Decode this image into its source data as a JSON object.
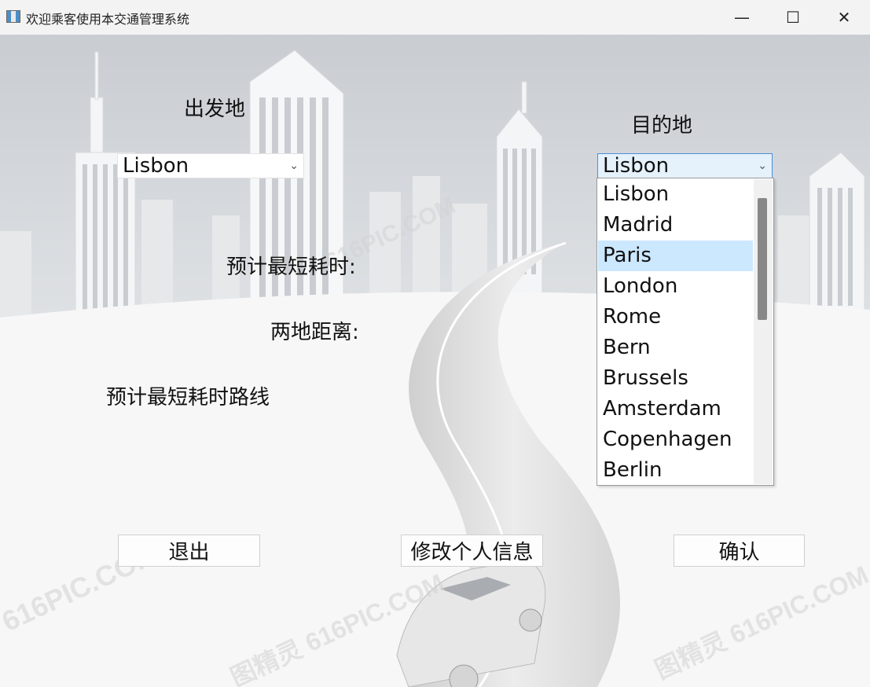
{
  "window": {
    "title": "欢迎乘客使用本交通管理系统",
    "minimize_glyph": "—",
    "maximize_glyph": "☐",
    "close_glyph": "✕"
  },
  "form": {
    "origin_label": "出发地",
    "destination_label": "目的地",
    "origin_value": "Lisbon",
    "destination_value": "Lisbon",
    "shortest_time_label": "预计最短耗时:",
    "distance_label": "两地距离:",
    "route_label": "预计最短耗时路线"
  },
  "destination_dropdown": {
    "options": [
      "Lisbon",
      "Madrid",
      "Paris",
      "London",
      "Rome",
      "Bern",
      "Brussels",
      "Amsterdam",
      "Copenhagen",
      "Berlin"
    ],
    "highlighted": "Paris"
  },
  "buttons": {
    "exit": "退出",
    "edit_profile": "修改个人信息",
    "confirm": "确认"
  },
  "background": {
    "watermark_text": "616PIC.COM",
    "watermark_text_2": "图精灵 616PIC.COM"
  }
}
